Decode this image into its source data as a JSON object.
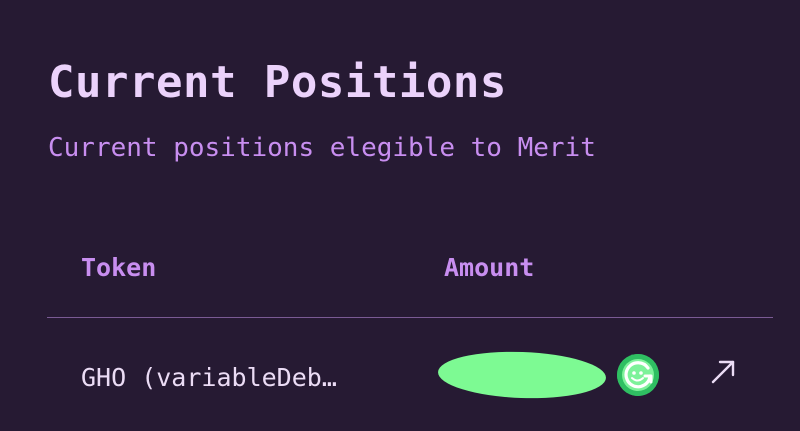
{
  "panel": {
    "title": "Current Positions",
    "subtitle": "Current positions elegible to Merit"
  },
  "table": {
    "columns": [
      "Token",
      "Amount"
    ],
    "rows": [
      {
        "token": "GHO (variableDeb…",
        "amount_redacted": true,
        "token_icon": "gho-token-icon",
        "action_icon": "external-link-arrow-icon"
      }
    ]
  },
  "colors": {
    "background": "#261a33",
    "title": "#ebd2fb",
    "accent": "#c88ef0",
    "divider": "#7a5a94",
    "redaction": "#7dfa93",
    "token_badge": "#2fbf62"
  }
}
